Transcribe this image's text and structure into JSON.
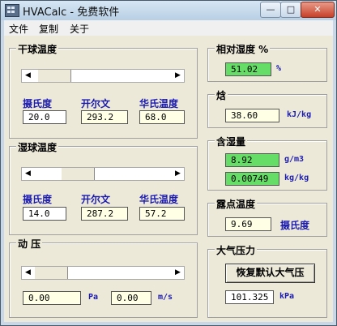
{
  "window": {
    "title": "HVACalc - 免费软件"
  },
  "titlebar_buttons": {
    "minimize": "—",
    "maximize": "□",
    "close": "✕"
  },
  "menu": [
    "文件",
    "复制",
    "关于"
  ],
  "dry_bulb": {
    "title": "干球温度",
    "labels": [
      "摄氏度",
      "开尔文",
      "华氏温度"
    ],
    "values": [
      "20.0",
      "293.2",
      "68.0"
    ],
    "slider_level": 0.03
  },
  "wet_bulb": {
    "title": "湿球温度",
    "labels": [
      "摄氏度",
      "开尔文",
      "华氏温度"
    ],
    "values": [
      "14.0",
      "287.2",
      "57.2"
    ],
    "slider_level": 0.25
  },
  "dynamic_pressure": {
    "title": "动 压",
    "values": [
      "0.00",
      "0.00"
    ],
    "units": [
      "Pa",
      "m/s"
    ],
    "slider_level": 0.0
  },
  "relative_humidity": {
    "title": "相对湿度 %",
    "value": "51.02",
    "unit": "%"
  },
  "enthalpy": {
    "title": "焓",
    "value": "38.60",
    "unit": "kJ/kg"
  },
  "humidity_ratio": {
    "title": "含湿量",
    "values": [
      "8.92",
      "0.00749"
    ],
    "units": [
      "g/m3",
      "kg/kg"
    ]
  },
  "dew_point": {
    "title": "露点温度",
    "value": "9.69",
    "unit": "摄氏度"
  },
  "atmospheric": {
    "title": "大气压力",
    "button": "恢复默认大气压",
    "value": "101.325",
    "unit": "kPa"
  },
  "icons": {
    "slider_left": "◀",
    "slider_right": "▶"
  },
  "colors": {
    "label_blue": "#1a1ab0",
    "field_green": "#66dd66",
    "field_cream": "#ffffe6"
  }
}
